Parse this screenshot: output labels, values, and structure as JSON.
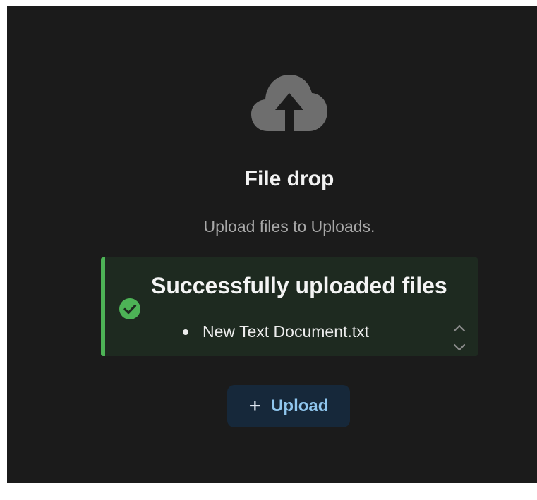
{
  "filedrop": {
    "title": "File drop",
    "subtitle": "Upload files to Uploads.",
    "icon": "cloud-upload-icon"
  },
  "alert": {
    "title": "Successfully uploaded files",
    "status": "success",
    "icon": "check-circle-icon",
    "files": [
      "New Text Document.txt"
    ]
  },
  "upload_button": {
    "icon": "plus-icon",
    "icon_glyph": "+",
    "label": "Upload"
  },
  "colors": {
    "background": "#1b1b1b",
    "success_accent": "#4db356",
    "button_bg": "#16283a",
    "button_text": "#8fc6ee",
    "icon_gray": "#6e6e6e"
  }
}
